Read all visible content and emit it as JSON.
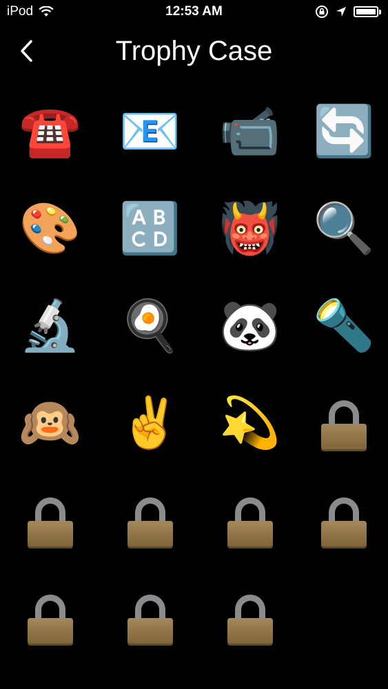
{
  "status_bar": {
    "carrier": "iPod",
    "time": "12:53 AM",
    "battery_level": 1.0
  },
  "nav": {
    "back_icon": "chevron-left-icon",
    "title": "Trophy Case"
  },
  "trophies": [
    {
      "name": "telephone",
      "icon": "☎️",
      "unlocked": true
    },
    {
      "name": "envelope",
      "icon": "📧",
      "unlocked": true
    },
    {
      "name": "video-camera",
      "icon": "📹",
      "unlocked": true
    },
    {
      "name": "refresh",
      "icon": "🔄",
      "unlocked": true
    },
    {
      "name": "palette",
      "icon": "🎨",
      "unlocked": true
    },
    {
      "name": "abcd",
      "icon": "🔠",
      "unlocked": true
    },
    {
      "name": "ogre",
      "icon": "👹",
      "unlocked": true
    },
    {
      "name": "magnifying-glass",
      "icon": "🔍",
      "unlocked": true
    },
    {
      "name": "microscope",
      "icon": "🔬",
      "unlocked": true
    },
    {
      "name": "cooking",
      "icon": "🍳",
      "unlocked": true
    },
    {
      "name": "panda",
      "icon": "🐼",
      "unlocked": true
    },
    {
      "name": "flashlight",
      "icon": "🔦",
      "unlocked": true
    },
    {
      "name": "hear-no-evil-monkey",
      "icon": "🙉",
      "unlocked": true
    },
    {
      "name": "victory-hand",
      "icon": "✌️",
      "unlocked": true
    },
    {
      "name": "dizzy",
      "icon": "💫",
      "unlocked": true
    },
    {
      "name": "locked",
      "icon": "lock-icon",
      "unlocked": false
    },
    {
      "name": "locked",
      "icon": "lock-icon",
      "unlocked": false
    },
    {
      "name": "locked",
      "icon": "lock-icon",
      "unlocked": false
    },
    {
      "name": "locked",
      "icon": "lock-icon",
      "unlocked": false
    },
    {
      "name": "locked",
      "icon": "lock-icon",
      "unlocked": false
    },
    {
      "name": "locked",
      "icon": "lock-icon",
      "unlocked": false
    },
    {
      "name": "locked",
      "icon": "lock-icon",
      "unlocked": false
    },
    {
      "name": "locked",
      "icon": "lock-icon",
      "unlocked": false
    }
  ],
  "colors": {
    "background": "#000000",
    "text": "#ffffff",
    "lock_shackle": "#8b8b8e",
    "lock_body": "#927548"
  }
}
